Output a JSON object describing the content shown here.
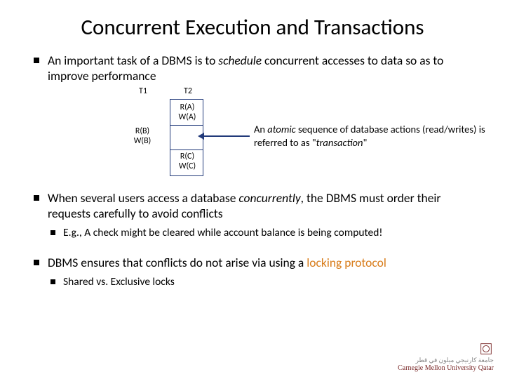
{
  "title": "Concurrent Execution and Transactions",
  "bullets": {
    "b1_pre": "An important task of a DBMS is to ",
    "b1_em": "schedule",
    "b1_post": " concurrent accesses to data so as to improve performance",
    "b2_pre": "When several users access a database ",
    "b2_em": "concurrently",
    "b2_post": ", the DBMS must order their requests carefully to avoid conflicts",
    "b2_sub": "E.g., A check might be cleared while account balance is being computed!",
    "b3_pre": "DBMS ensures that conflicts do not arise  via using a ",
    "b3_link": "locking protocol",
    "b3_sub": "Shared vs. Exclusive locks"
  },
  "diagram": {
    "col1": "T1",
    "col2": "T2",
    "ra": "R(A)",
    "wa": "W(A)",
    "rb": "R(B)",
    "wb": "W(B)",
    "rc": "R(C)",
    "wc": "W(C)",
    "callout_pre": "An ",
    "callout_em": "atomic",
    "callout_mid": " sequence of database actions (read/writes) is referred to as \"",
    "callout_em2": "transaction",
    "callout_post": "\""
  },
  "footer": {
    "arabic": "جامعة كارنيجي ميلون في قطر",
    "en": "Carnegie Mellon University Qatar"
  }
}
